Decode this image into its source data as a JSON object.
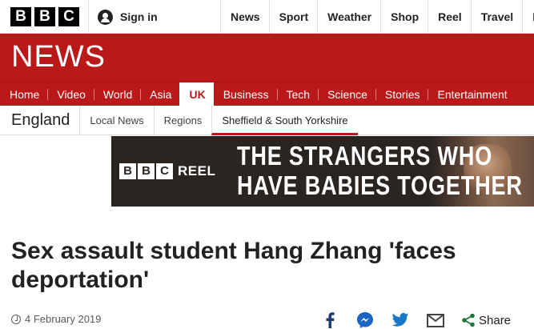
{
  "header": {
    "logo_letters": [
      "B",
      "B",
      "C"
    ],
    "sign_in": "Sign in",
    "top_nav": [
      "News",
      "Sport",
      "Weather",
      "Shop",
      "Reel",
      "Travel",
      "Mo"
    ]
  },
  "section": {
    "title": "NEWS"
  },
  "main_nav": {
    "items": [
      "Home",
      "Video",
      "World",
      "Asia",
      "UK",
      "Business",
      "Tech",
      "Science",
      "Stories",
      "Entertainment"
    ],
    "active": "UK"
  },
  "sub_nav": {
    "region": "England",
    "items": [
      "Local News",
      "Regions",
      "Sheffield & South Yorkshire"
    ],
    "active": "Sheffield & South Yorkshire"
  },
  "banner": {
    "logo_letters": [
      "B",
      "B",
      "C"
    ],
    "logo_suffix": "REEL",
    "headline_line1": "THE STRANGERS WHO",
    "headline_line2": "HAVE BABIES TOGETHER"
  },
  "article": {
    "title": "Sex assault student Hang Zhang 'faces deportation'",
    "date": "4 February 2019",
    "share_label": "Share",
    "share_icons": [
      "facebook-icon",
      "messenger-icon",
      "twitter-icon",
      "email-icon",
      "share-icon"
    ]
  },
  "colors": {
    "brand_red": "#bb1919",
    "text": "#222222"
  }
}
